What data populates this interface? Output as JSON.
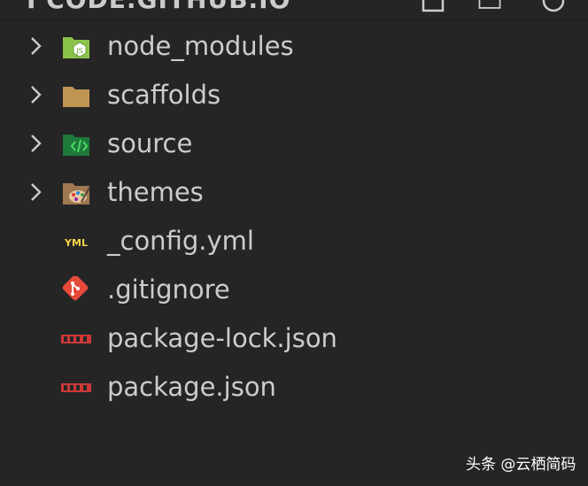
{
  "explorer": {
    "title": "I CODE.GITHUB.IO",
    "actions": [
      "new-file-icon",
      "new-folder-icon",
      "refresh-icon"
    ]
  },
  "tree": {
    "items": [
      {
        "label": "node_modules",
        "type": "folder",
        "expandable": true,
        "icon": "node-modules-folder-icon",
        "icon_color": "#8bc34a"
      },
      {
        "label": "scaffolds",
        "type": "folder",
        "expandable": true,
        "icon": "folder-icon",
        "icon_color": "#c09553"
      },
      {
        "label": "source",
        "type": "folder",
        "expandable": true,
        "icon": "source-folder-icon",
        "icon_color": "#1e7a3a"
      },
      {
        "label": "themes",
        "type": "folder",
        "expandable": true,
        "icon": "themes-folder-icon",
        "icon_color": "#a07850"
      },
      {
        "label": "_config.yml",
        "type": "file",
        "expandable": false,
        "icon": "yaml-icon",
        "icon_color": "#f5d547"
      },
      {
        "label": ".gitignore",
        "type": "file",
        "expandable": false,
        "icon": "git-icon",
        "icon_color": "#e64a3a"
      },
      {
        "label": "package-lock.json",
        "type": "file",
        "expandable": false,
        "icon": "npm-icon",
        "icon_color": "#cb3837"
      },
      {
        "label": "package.json",
        "type": "file",
        "expandable": false,
        "icon": "npm-icon",
        "icon_color": "#cb3837"
      }
    ]
  },
  "watermark": {
    "text": "头条 @云栖简码"
  },
  "colors": {
    "background": "#252526",
    "text": "#cccccc"
  }
}
